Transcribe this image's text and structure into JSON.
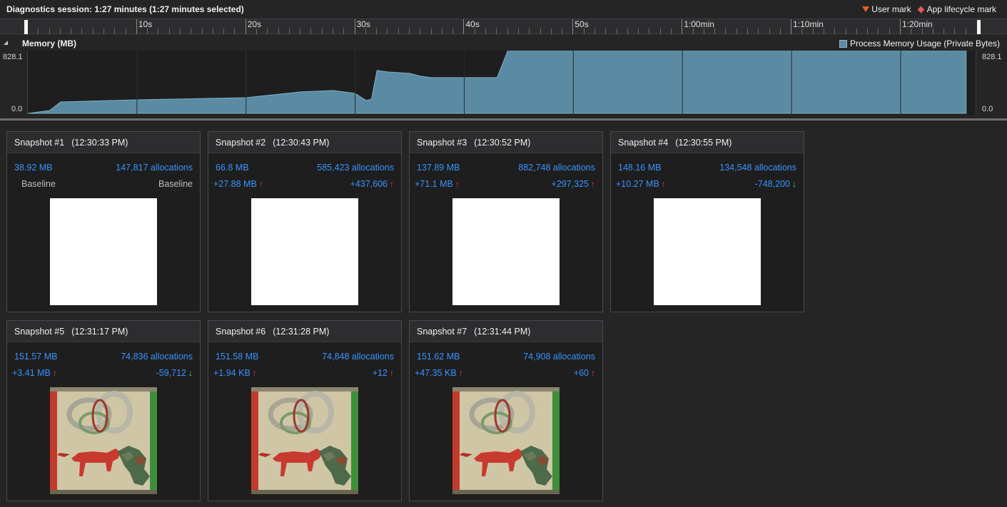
{
  "session": {
    "title": "Diagnostics session: 1:27 minutes (1:27 minutes selected)",
    "user_mark_label": "User mark",
    "lifecycle_mark_label": "App lifecycle mark"
  },
  "ruler": {
    "labels": [
      "10s",
      "20s",
      "30s",
      "40s",
      "50s",
      "1:00min",
      "1:10min",
      "1:20min"
    ]
  },
  "memory": {
    "title": "Memory (MB)",
    "legend_label": "Process Memory Usage (Private Bytes)",
    "y_max_label": "828.1",
    "y_min_label": "0.0",
    "color": "#5b8ba3"
  },
  "chart_data": {
    "type": "area",
    "title": "Memory (MB)",
    "series": [
      {
        "name": "Process Memory Usage (Private Bytes)",
        "x": [
          0,
          1,
          2,
          3,
          10,
          20,
          25,
          28,
          30,
          31,
          31.5,
          32,
          33,
          35,
          36,
          37,
          43,
          44,
          86
        ],
        "values": [
          0,
          20,
          40,
          160,
          190,
          220,
          300,
          320,
          280,
          180,
          200,
          600,
          580,
          560,
          520,
          500,
          500,
          880,
          880
        ]
      }
    ],
    "xlim": [
      0,
      87
    ],
    "ylim": [
      0,
      828.1
    ],
    "grid": true
  },
  "snapshots": [
    {
      "title": "Snapshot #1",
      "time": "(12:30:33 PM)",
      "size": "38.92 MB",
      "allocs": "147,817 allocations",
      "size_diff": "Baseline",
      "alloc_diff": "Baseline",
      "size_dir": "",
      "alloc_dir": "",
      "thumb": "blank"
    },
    {
      "title": "Snapshot #2",
      "time": "(12:30:43 PM)",
      "size": "66.8 MB",
      "allocs": "585,423 allocations",
      "size_diff": "+27.88 MB",
      "alloc_diff": "+437,606",
      "size_dir": "up",
      "alloc_dir": "up",
      "thumb": "blank"
    },
    {
      "title": "Snapshot #3",
      "time": "(12:30:52 PM)",
      "size": "137.89 MB",
      "allocs": "882,748 allocations",
      "size_diff": "+71.1 MB",
      "alloc_diff": "+297,325",
      "size_dir": "up",
      "alloc_dir": "up",
      "thumb": "blank"
    },
    {
      "title": "Snapshot #4",
      "time": "(12:30:55 PM)",
      "size": "148.16 MB",
      "allocs": "134,548 allocations",
      "size_diff": "+10.27 MB",
      "alloc_diff": "-748,200",
      "size_dir": "up",
      "alloc_dir": "down",
      "thumb": "blank"
    },
    {
      "title": "Snapshot #5",
      "time": "(12:31:17 PM)",
      "size": "151.57 MB",
      "allocs": "74,836 allocations",
      "size_diff": "+3.41 MB",
      "alloc_diff": "-59,712",
      "size_dir": "up",
      "alloc_dir": "down",
      "thumb": "scene"
    },
    {
      "title": "Snapshot #6",
      "time": "(12:31:28 PM)",
      "size": "151.58 MB",
      "allocs": "74,848 allocations",
      "size_diff": "+1.94 KB",
      "alloc_diff": "+12",
      "size_dir": "up",
      "alloc_dir": "up",
      "thumb": "scene"
    },
    {
      "title": "Snapshot #7",
      "time": "(12:31:44 PM)",
      "size": "151.62 MB",
      "allocs": "74,908 allocations",
      "size_diff": "+47.35 KB",
      "alloc_diff": "+60",
      "size_dir": "up",
      "alloc_dir": "up",
      "thumb": "scene"
    }
  ],
  "icons": {
    "up": "arrow-up-icon",
    "down": "arrow-down-icon",
    "user_mark": "triangle-down-icon",
    "lifecycle": "diamond-icon"
  }
}
